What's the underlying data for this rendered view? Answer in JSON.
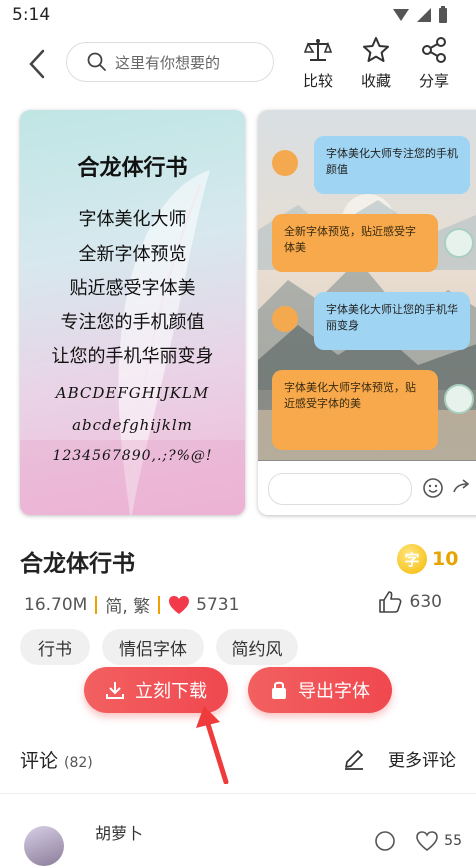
{
  "status": {
    "time": "5:14"
  },
  "search": {
    "placeholder": "这里有你想要的"
  },
  "actions": [
    {
      "label": "比较",
      "icon": "scale-icon"
    },
    {
      "label": "收藏",
      "icon": "star-icon"
    },
    {
      "label": "分享",
      "icon": "share-icon"
    }
  ],
  "preview1": {
    "lines": [
      "合龙体行书",
      "字体美化大师",
      "全新字体预览",
      "贴近感受字体美",
      "专注您的手机颜值",
      "让您的手机华丽变身",
      "ABCDEFGHIJKLM",
      "abcdefghijklm",
      "1234567890,.;?%@!"
    ]
  },
  "preview2": {
    "messages": [
      {
        "text": "字体美化大师专注您的手机颜值",
        "side": "left",
        "color": "blue"
      },
      {
        "text": "全新字体预览，贴近感受字体美",
        "side": "right",
        "color": "orange"
      },
      {
        "text": "字体美化大师让您的手机华丽变身",
        "side": "left",
        "color": "blue"
      },
      {
        "text": "字体美化大师字体预览，贴近感受字体的美",
        "side": "right",
        "color": "orange"
      }
    ]
  },
  "font": {
    "name": "合龙体行书",
    "coin_icon_text": "字",
    "price": "10",
    "size": "16.70M",
    "charset": "简, 繁",
    "hearts": "5731",
    "likes": "630"
  },
  "tags": [
    "行书",
    "情侣字体",
    "简约风"
  ],
  "buttons": {
    "download": "立刻下载",
    "export": "导出字体"
  },
  "comments": {
    "title": "评论",
    "count": "(82)",
    "more": "更多评论"
  },
  "first_comment": {
    "user": "胡萝卜",
    "likes": "55"
  },
  "colors": {
    "accent": "#f0484f",
    "coin": "#e8a400"
  }
}
